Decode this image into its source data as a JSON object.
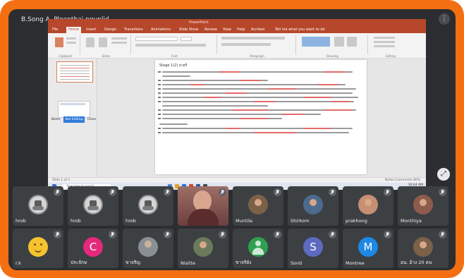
{
  "meeting": {
    "title": "B.Song A. Ploenthai.ngunlid",
    "more_label": "⋮",
    "fullscreen_label": "⤢"
  },
  "shared_screen": {
    "powerpoint": {
      "title": "PowerPoint",
      "tabs": [
        "File",
        "Home",
        "Insert",
        "Design",
        "Transitions",
        "Animations",
        "Slide Show",
        "Review",
        "View",
        "Help",
        "Acrobat"
      ],
      "search_placeholder": "Tell me what you want to do",
      "ribbon_groups": [
        "Clipboard",
        "Slides",
        "Font",
        "Paragraph",
        "Drawing",
        "Editing"
      ],
      "slide_heading": "Stage 1(2) ยาตรี",
      "notification_buttons": [
        "Notes",
        "Not Editing",
        "Close"
      ],
      "status_left": "Slide 1 of 1",
      "status_right": "Notes   Comments   80%"
    },
    "taskbar": {
      "search_placeholder": "Type here to search",
      "clock": "10:44 AM"
    }
  },
  "participants": [
    {
      "name": "hrob",
      "avatar": "hrdb"
    },
    {
      "name": "hrob",
      "avatar": "hrdb"
    },
    {
      "name": "hrob",
      "avatar": "hrdb"
    },
    {
      "name": "",
      "avatar": "speaking"
    },
    {
      "name": "Muntila",
      "avatar": "photo"
    },
    {
      "name": "Shirkom",
      "avatar": "photo"
    },
    {
      "name": "prakhong",
      "avatar": "photo"
    },
    {
      "name": "Monthiya",
      "avatar": "photo"
    },
    {
      "name": "r.k",
      "avatar": "emoji"
    },
    {
      "name": "ประจักษ",
      "avatar": "C",
      "color": "#e4287c"
    },
    {
      "name": "ขาจริญ",
      "avatar": "person"
    },
    {
      "name": "Nisitte",
      "avatar": "photo"
    },
    {
      "name": "ขาจริยัง",
      "avatar": "generic"
    },
    {
      "name": "Sonti",
      "avatar": "S",
      "color": "#5c6bc0"
    },
    {
      "name": "Montree",
      "avatar": "M",
      "color": "#1e88e5"
    },
    {
      "name": "อน. อ้าง 20 คน",
      "avatar": "photo"
    }
  ]
}
